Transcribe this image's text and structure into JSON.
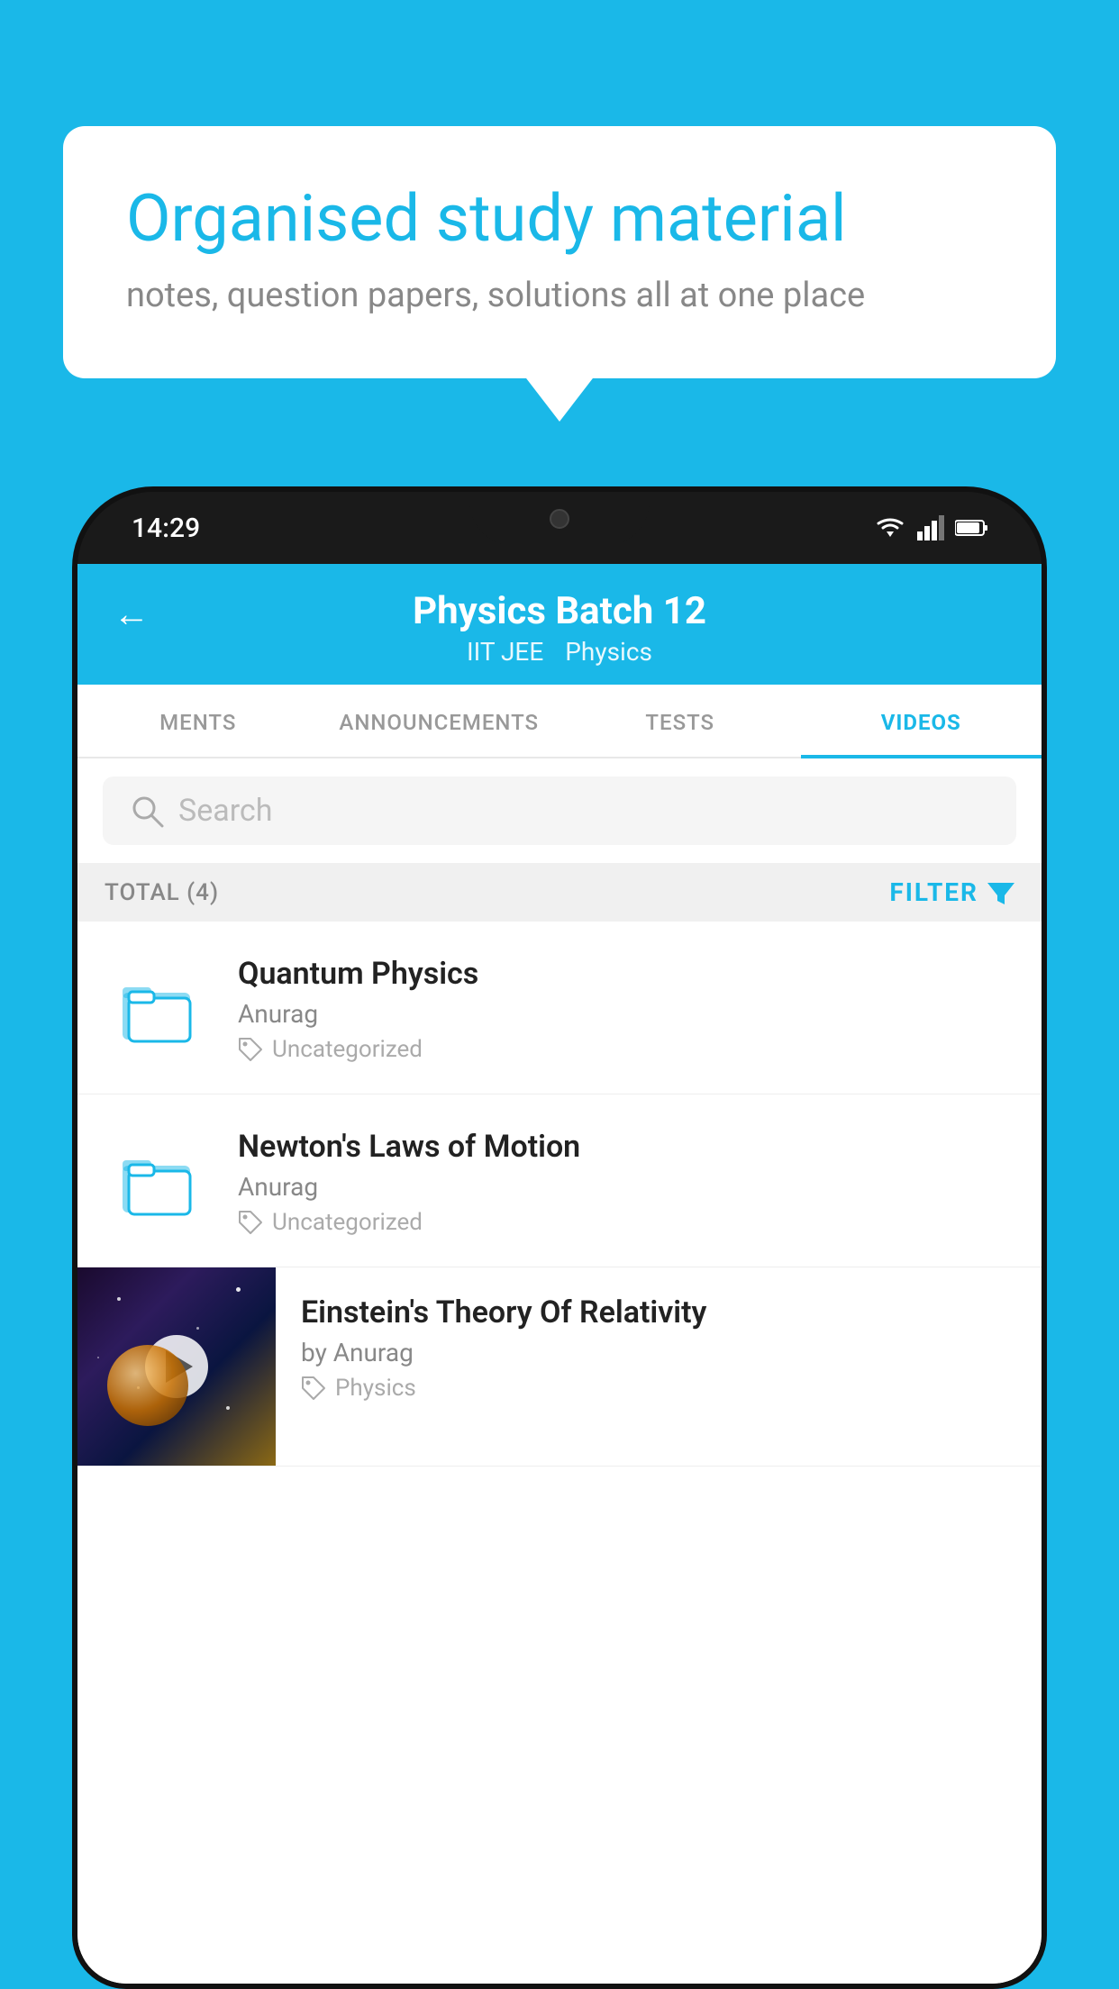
{
  "background": {
    "color": "#1ab8e8"
  },
  "speech_bubble": {
    "title": "Organised study material",
    "subtitle": "notes, question papers, solutions all at one place"
  },
  "status_bar": {
    "time": "14:29",
    "wifi": "wifi",
    "signal": "signal",
    "battery": "battery"
  },
  "app_header": {
    "back_label": "←",
    "title": "Physics Batch 12",
    "subtitle_left": "IIT JEE",
    "subtitle_right": "Physics"
  },
  "tabs": [
    {
      "label": "MENTS",
      "active": false
    },
    {
      "label": "ANNOUNCEMENTS",
      "active": false
    },
    {
      "label": "TESTS",
      "active": false
    },
    {
      "label": "VIDEOS",
      "active": true
    }
  ],
  "search": {
    "placeholder": "Search"
  },
  "filter_bar": {
    "total": "TOTAL (4)",
    "filter_label": "FILTER"
  },
  "videos": [
    {
      "id": 1,
      "title": "Quantum Physics",
      "author": "Anurag",
      "tag": "Uncategorized",
      "type": "folder"
    },
    {
      "id": 2,
      "title": "Newton's Laws of Motion",
      "author": "Anurag",
      "tag": "Uncategorized",
      "type": "folder"
    },
    {
      "id": 3,
      "title": "Einstein's Theory Of Relativity",
      "author": "by Anurag",
      "tag": "Physics",
      "type": "video"
    }
  ]
}
